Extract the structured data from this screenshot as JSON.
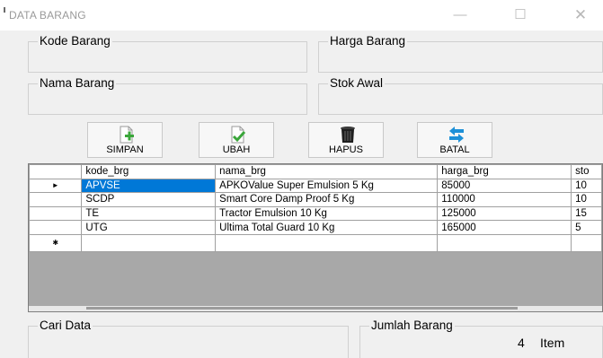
{
  "window": {
    "title": "DATA BARANG",
    "min_glyph": "—",
    "max_glyph": "☐",
    "close_glyph": "✕"
  },
  "fields": {
    "kode_barang": "Kode Barang",
    "harga_barang": "Harga Barang",
    "nama_barang": "Nama Barang",
    "stok_awal": "Stok Awal"
  },
  "buttons": {
    "simpan": "SIMPAN",
    "ubah": "UBAH",
    "hapus": "HAPUS",
    "batal": "BATAL"
  },
  "icons": {
    "simpan": "add-document-icon",
    "ubah": "edit-document-icon",
    "hapus": "trash-bin-icon",
    "batal": "undo-arrows-icon"
  },
  "grid": {
    "columns": [
      "kode_brg",
      "nama_brg",
      "harga_brg",
      "sto"
    ],
    "rows": [
      [
        "APVSE",
        "APKOValue Super Emulsion 5 Kg",
        "85000",
        "10"
      ],
      [
        "SCDP",
        "Smart Core Damp Proof 5 Kg",
        "110000",
        "10"
      ],
      [
        "TE",
        "Tractor Emulsion 10 Kg",
        "125000",
        "15"
      ],
      [
        "UTG",
        "Ultima Total Guard 10 Kg",
        "165000",
        "5"
      ]
    ],
    "current_row_marker": "►",
    "new_row_marker": "✱"
  },
  "search": {
    "label": "Cari Data"
  },
  "count": {
    "label": "Jumlah Barang",
    "value": "4",
    "unit": "Item"
  },
  "colors": {
    "selection": "#0078d7",
    "window_bg": "#f0f0f0",
    "grid_empty": "#a8a8a8"
  }
}
